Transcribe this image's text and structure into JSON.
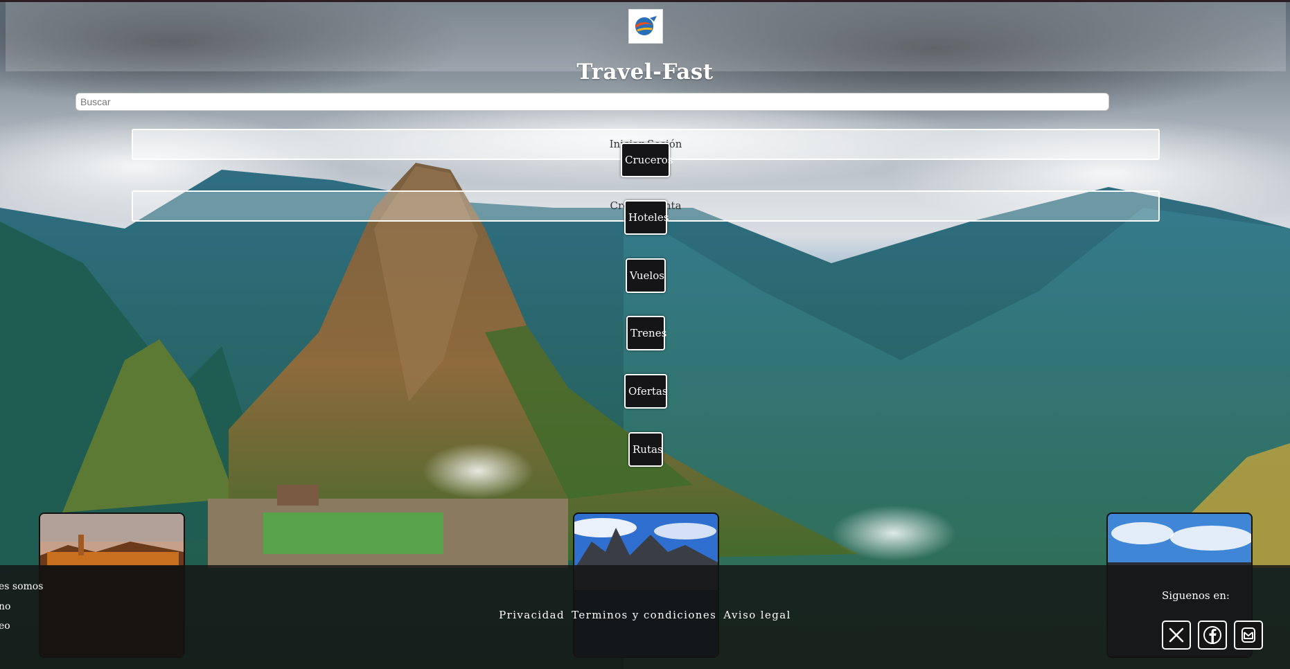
{
  "site": {
    "title": "Travel-Fast"
  },
  "search": {
    "placeholder": "Buscar"
  },
  "account": {
    "login_label": "Iniciar Sesión",
    "register_label": "Crear Cuenta"
  },
  "nav": {
    "items": [
      "Cruceros",
      "Hoteles",
      "Vuelos",
      "Trenes",
      "Ofertas",
      "Rutas"
    ]
  },
  "footer": {
    "links": [
      "es somos",
      "no",
      "eo"
    ],
    "legal": [
      "Privacidad",
      "Terminos y condiciones",
      "Aviso legal"
    ],
    "follow_label": "Siguenos en:",
    "social": [
      "x-icon",
      "facebook-icon",
      "mail-icon"
    ]
  },
  "colors": {
    "nav_bg": "#151517",
    "footer_bg": "#141414",
    "accent": "#ffffff"
  }
}
